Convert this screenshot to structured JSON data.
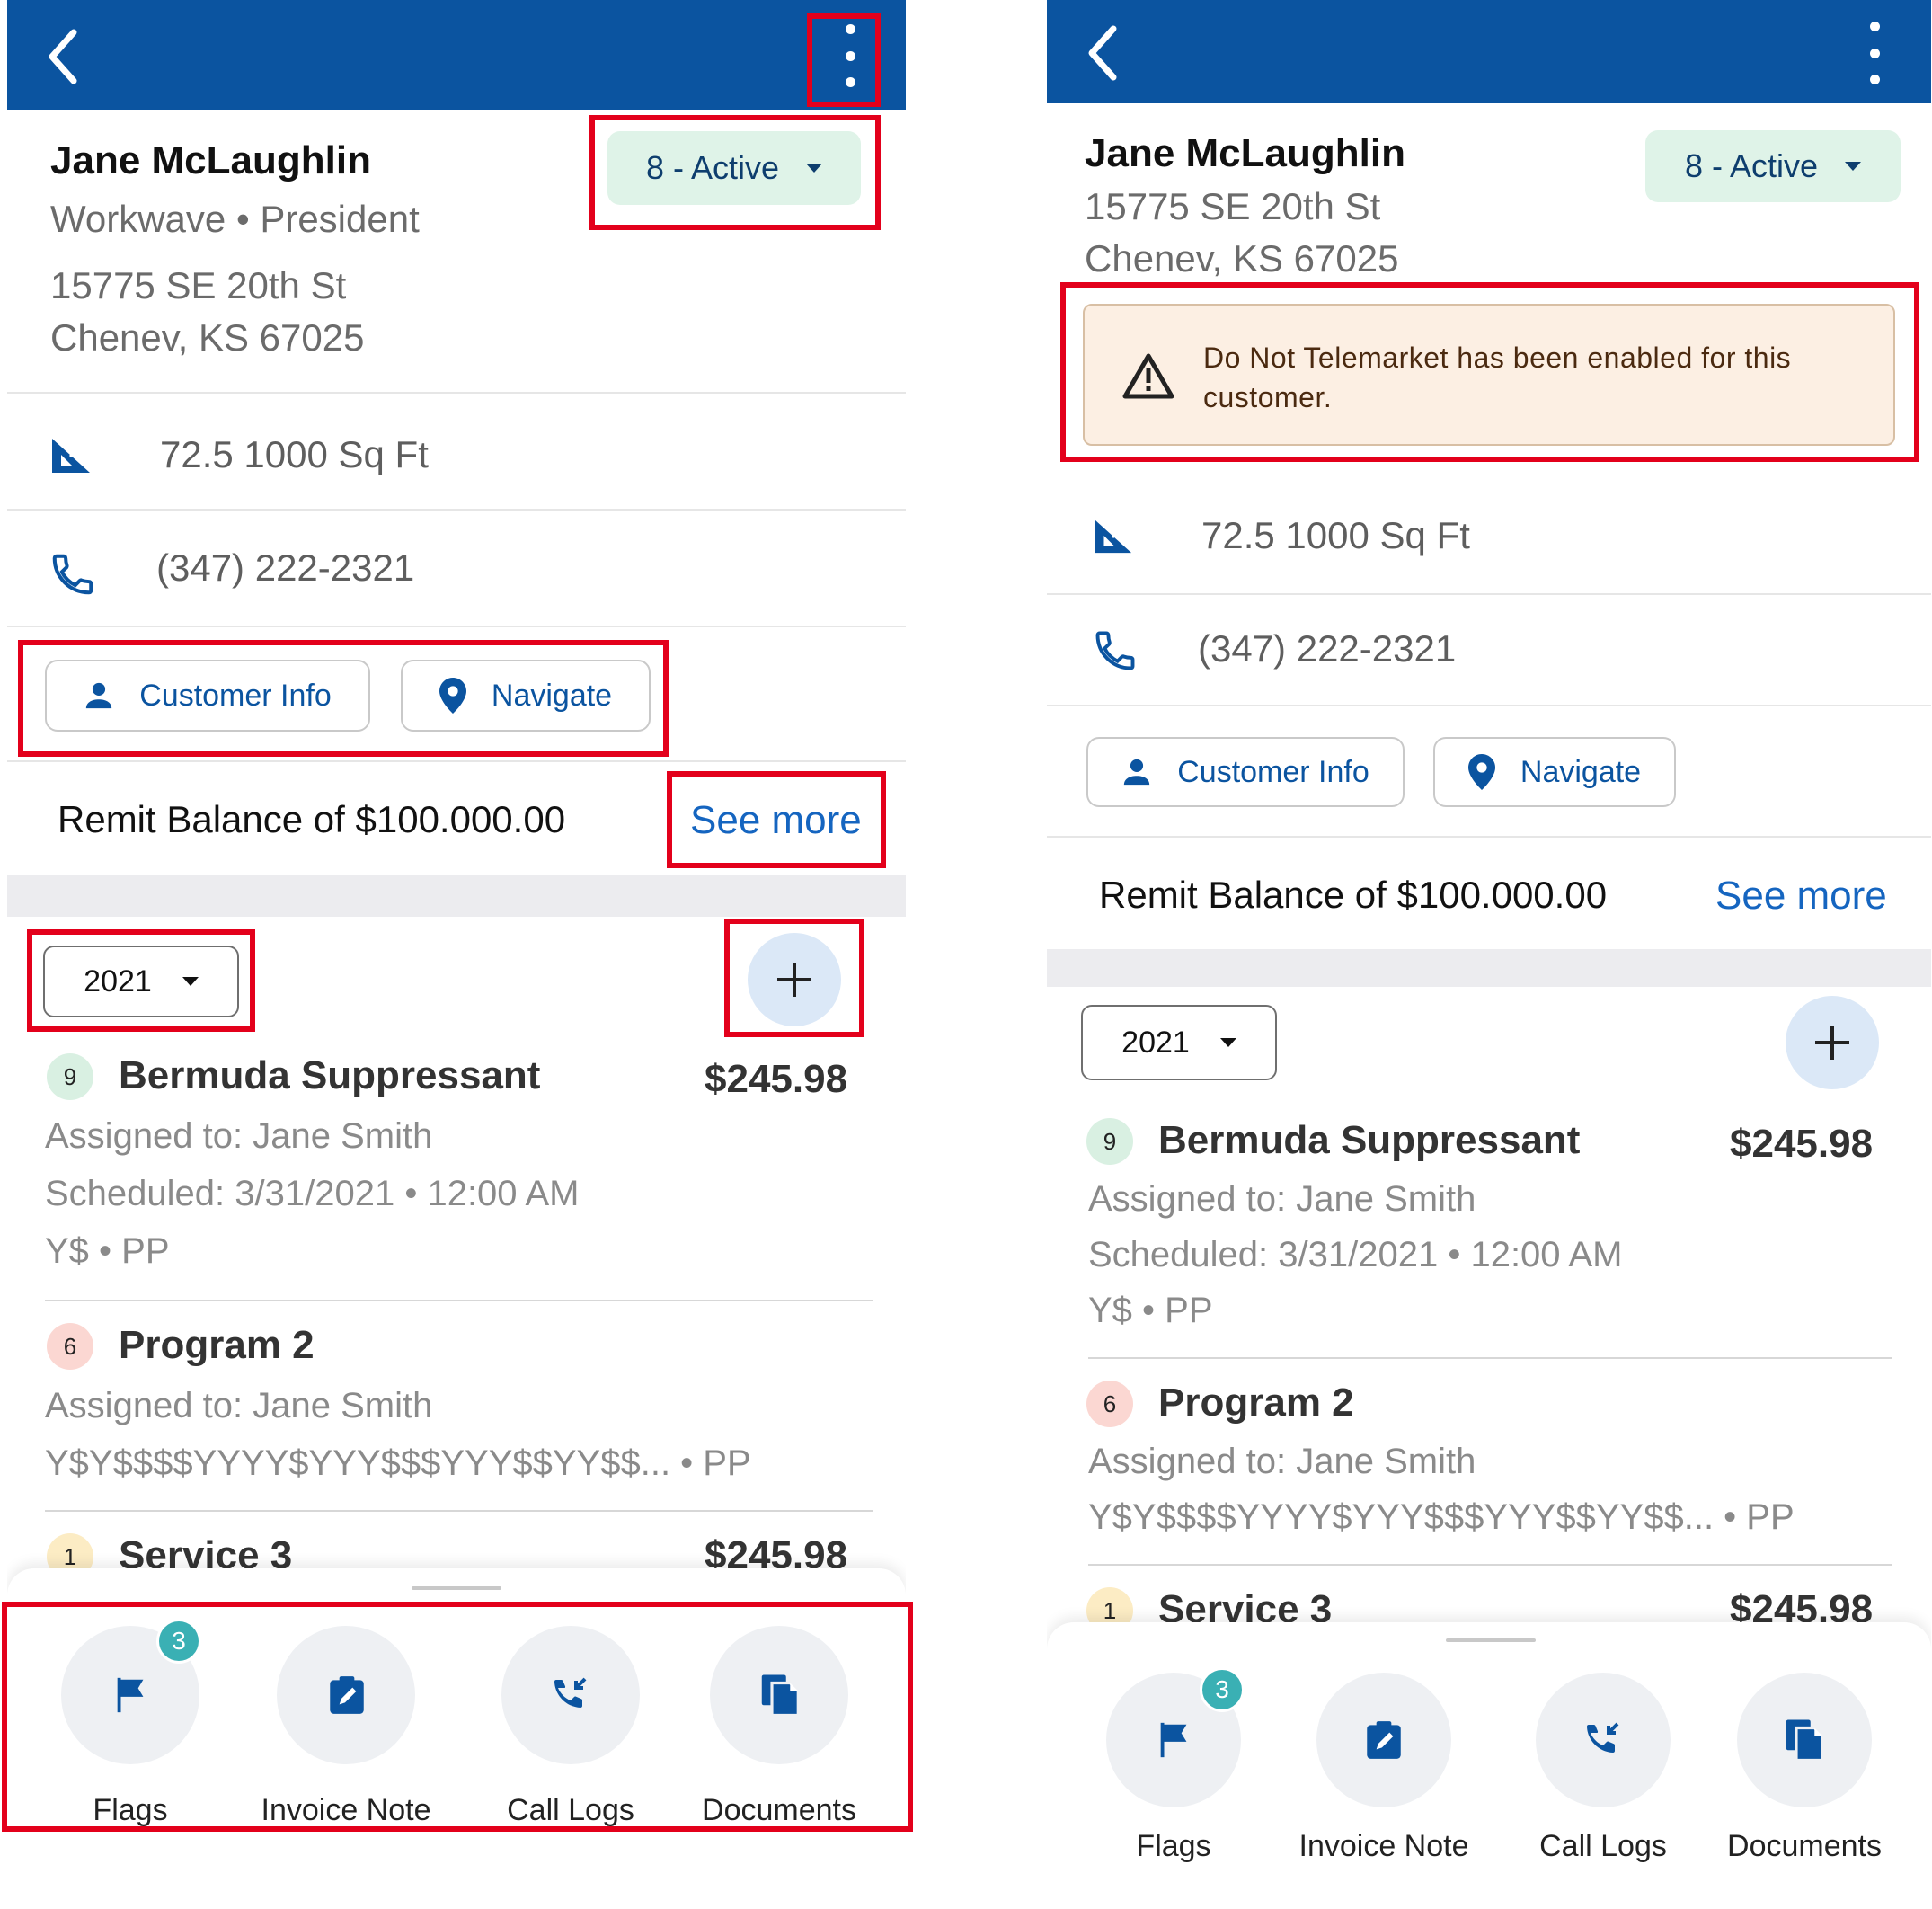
{
  "colors": {
    "topbar": "#0b54a0",
    "accent": "#1565c0",
    "status_bg": "#dff3e8",
    "warning_bg": "#fcefe3",
    "badge": "#3ab0b4",
    "highlight": "#e3001b"
  },
  "customer": {
    "name": "Jane McLaughlin",
    "company_role": "Workwave • President",
    "address_line1": "15775 SE 20th St",
    "address_line2": "Chenev, KS 67025",
    "status_label": "8 - Active",
    "sqft": "72.5 1000 Sq Ft",
    "phone": "(347) 222-2321"
  },
  "warning": {
    "message": "Do Not Telemarket has been enabled for this customer.",
    "icon": "warning-triangle-icon"
  },
  "actions": {
    "customer_info": "Customer Info",
    "navigate": "Navigate"
  },
  "remit": {
    "text": "Remit Balance of $100.000.00",
    "see_more": "See more"
  },
  "year_filter": {
    "selected": "2021"
  },
  "services": [
    {
      "number": "9",
      "title": "Bermuda Suppressant",
      "price": "$245.98",
      "assigned": "Assigned to: Jane Smith",
      "scheduled": "Scheduled: 3/31/2021 • 12:00 AM",
      "codes": "Y$ • PP"
    },
    {
      "number": "6",
      "title": "Program 2",
      "assigned": "Assigned to: Jane Smith",
      "codes": "Y$Y$$$$YYYY$YYY$$$YYY$$YY$$... • PP"
    },
    {
      "number": "1",
      "title": "Service 3",
      "price": "$245.98"
    }
  ],
  "toolbar": {
    "flags": "Flags",
    "flags_count": "3",
    "invoice_note": "Invoice Note",
    "call_logs": "Call Logs",
    "documents": "Documents"
  }
}
